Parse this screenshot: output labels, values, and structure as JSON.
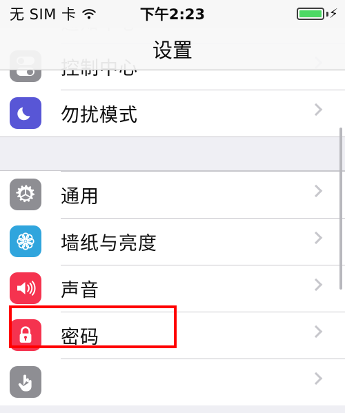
{
  "statusbar": {
    "carrier": "无 SIM 卡",
    "wifi_icon": "wifi-icon",
    "time": "下午2:23",
    "battery_icon": "battery-icon",
    "charging_icon": "lightning-bolt-icon",
    "battery_color": "#4cd964"
  },
  "navbar": {
    "title": "设置"
  },
  "scroll": {
    "indicator": "scroll-indicator"
  },
  "groups": [
    {
      "rows": [
        {
          "label": "通知中心",
          "icon": "notification-center-icon",
          "icon_color": "#e9e9ec",
          "faded": true
        },
        {
          "label": "控制中心",
          "icon": "control-center-icon",
          "icon_color": "#8e8e93",
          "faded": false
        },
        {
          "label": "勿扰模式",
          "icon": "moon-icon",
          "icon_color": "#5856d6",
          "faded": false
        }
      ]
    },
    {
      "rows": [
        {
          "label": "通用",
          "icon": "gear-icon",
          "icon_color": "#8e8e93",
          "faded": false
        },
        {
          "label": "墙纸与亮度",
          "icon": "flower-wallpaper-icon",
          "icon_color": "#30a5dd",
          "faded": false
        },
        {
          "label": "声音",
          "icon": "speaker-icon",
          "icon_color": "#f5334f",
          "faded": false
        },
        {
          "label": "密码",
          "icon": "lock-icon",
          "icon_color": "#f5334f",
          "faded": false
        },
        {
          "label": "",
          "icon": "privacy-hand-icon",
          "icon_color": "#8e8e93",
          "faded": false
        }
      ]
    }
  ],
  "annotation": {
    "name": "sounds-row-highlight",
    "color": "#ff0000",
    "target_label": "声音"
  },
  "chevron_icon": "chevron-right-icon"
}
